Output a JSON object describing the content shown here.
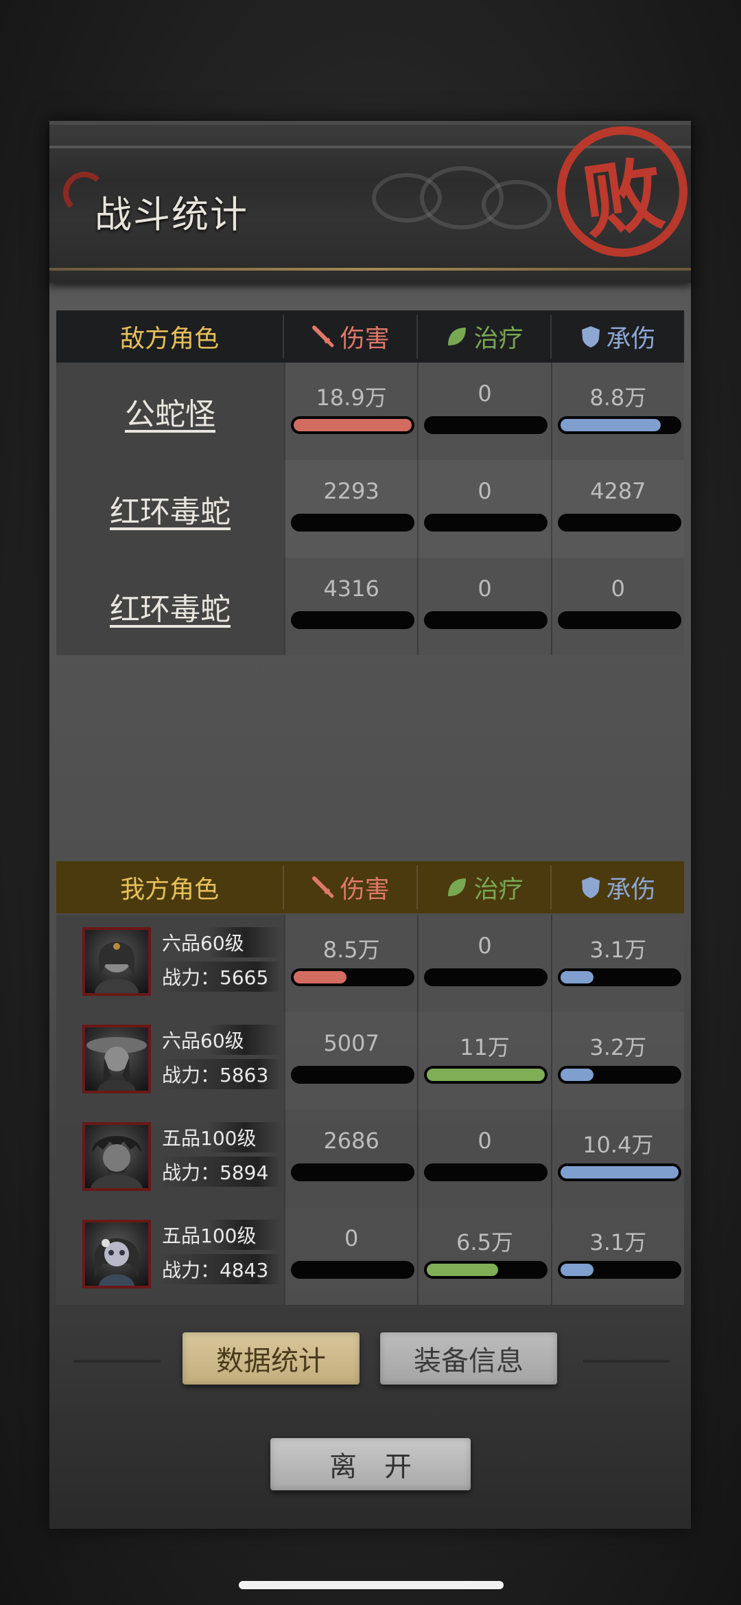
{
  "title": "战斗统计",
  "result_seal": "败",
  "columns": {
    "damage": "伤害",
    "heal": "治疗",
    "tank": "承伤"
  },
  "enemy": {
    "header": "敌方角色",
    "rows": [
      {
        "name": "公蛇怪",
        "damage": "18.9万",
        "damage_fill": 1.0,
        "heal": "0",
        "heal_fill": 0,
        "tank": "8.8万",
        "tank_fill": 0.85
      },
      {
        "name": "红环毒蛇",
        "damage": "2293",
        "damage_fill": 0,
        "heal": "0",
        "heal_fill": 0,
        "tank": "4287",
        "tank_fill": 0
      },
      {
        "name": "红环毒蛇",
        "damage": "4316",
        "damage_fill": 0,
        "heal": "0",
        "heal_fill": 0,
        "tank": "0",
        "tank_fill": 0
      }
    ]
  },
  "ally": {
    "header": "我方角色",
    "rows": [
      {
        "rank": "六品60级",
        "power": "战力：5665",
        "damage": "8.5万",
        "damage_fill": 0.45,
        "heal": "0",
        "heal_fill": 0,
        "tank": "3.1万",
        "tank_fill": 0.28
      },
      {
        "rank": "六品60级",
        "power": "战力：5863",
        "damage": "5007",
        "damage_fill": 0,
        "heal": "11万",
        "heal_fill": 1.0,
        "tank": "3.2万",
        "tank_fill": 0.28
      },
      {
        "rank": "五品100级",
        "power": "战力：5894",
        "damage": "2686",
        "damage_fill": 0,
        "heal": "0",
        "heal_fill": 0,
        "tank": "10.4万",
        "tank_fill": 1.0
      },
      {
        "rank": "五品100级",
        "power": "战力：4843",
        "damage": "0",
        "damage_fill": 0,
        "heal": "6.5万",
        "heal_fill": 0.6,
        "tank": "3.1万",
        "tank_fill": 0.28
      }
    ]
  },
  "buttons": {
    "data_stats": "数据统计",
    "equipment_info": "装备信息",
    "leave": "离开"
  },
  "colors": {
    "damage": "#d36c60",
    "heal": "#7fae57",
    "tank": "#7f9fcf",
    "enemy_header_text": "#e8c05a",
    "seal": "#c0392b"
  },
  "icons": {
    "damage": "sword-icon",
    "heal": "leaf-icon",
    "tank": "shield-icon"
  }
}
